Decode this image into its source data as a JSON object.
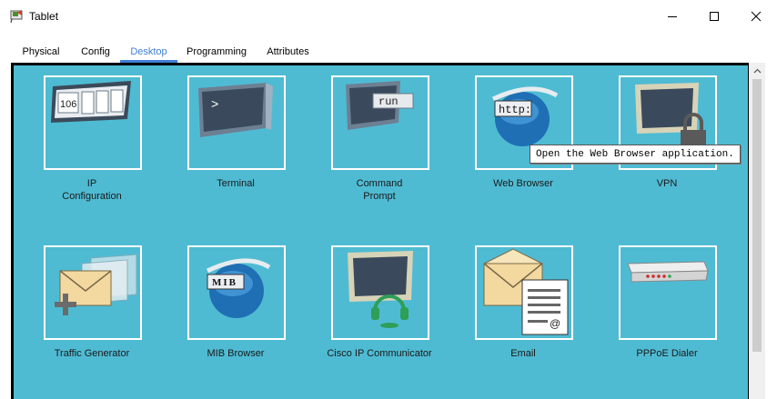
{
  "window": {
    "title": "Tablet",
    "controls": {
      "minimize": "minimize-icon",
      "maximize": "maximize-icon",
      "close": "close-icon"
    }
  },
  "tabs": [
    {
      "label": "Physical",
      "active": false
    },
    {
      "label": "Config",
      "active": false
    },
    {
      "label": "Desktop",
      "active": true
    },
    {
      "label": "Programming",
      "active": false
    },
    {
      "label": "Attributes",
      "active": false
    }
  ],
  "desktop": {
    "background": "#4fbbd3",
    "apps": [
      {
        "label": "IP\nConfiguration",
        "icon": "ip-configuration-icon",
        "icon_text": "106"
      },
      {
        "label": "Terminal",
        "icon": "terminal-icon",
        "icon_text": ">"
      },
      {
        "label": "Command\nPrompt",
        "icon": "command-prompt-icon",
        "icon_text": "run"
      },
      {
        "label": "Web Browser",
        "icon": "web-browser-icon",
        "icon_text": "http:"
      },
      {
        "label": "VPN",
        "icon": "vpn-icon"
      },
      {
        "label": "Traffic Generator",
        "icon": "traffic-generator-icon"
      },
      {
        "label": "MIB Browser",
        "icon": "mib-browser-icon",
        "icon_text": "MIB"
      },
      {
        "label": "Cisco IP Communicator",
        "icon": "cisco-ip-communicator-icon"
      },
      {
        "label": "Email",
        "icon": "email-icon",
        "icon_text": "@"
      },
      {
        "label": "PPPoE Dialer",
        "icon": "pppoe-dialer-icon"
      }
    ],
    "tooltip": "Open the Web Browser application."
  }
}
